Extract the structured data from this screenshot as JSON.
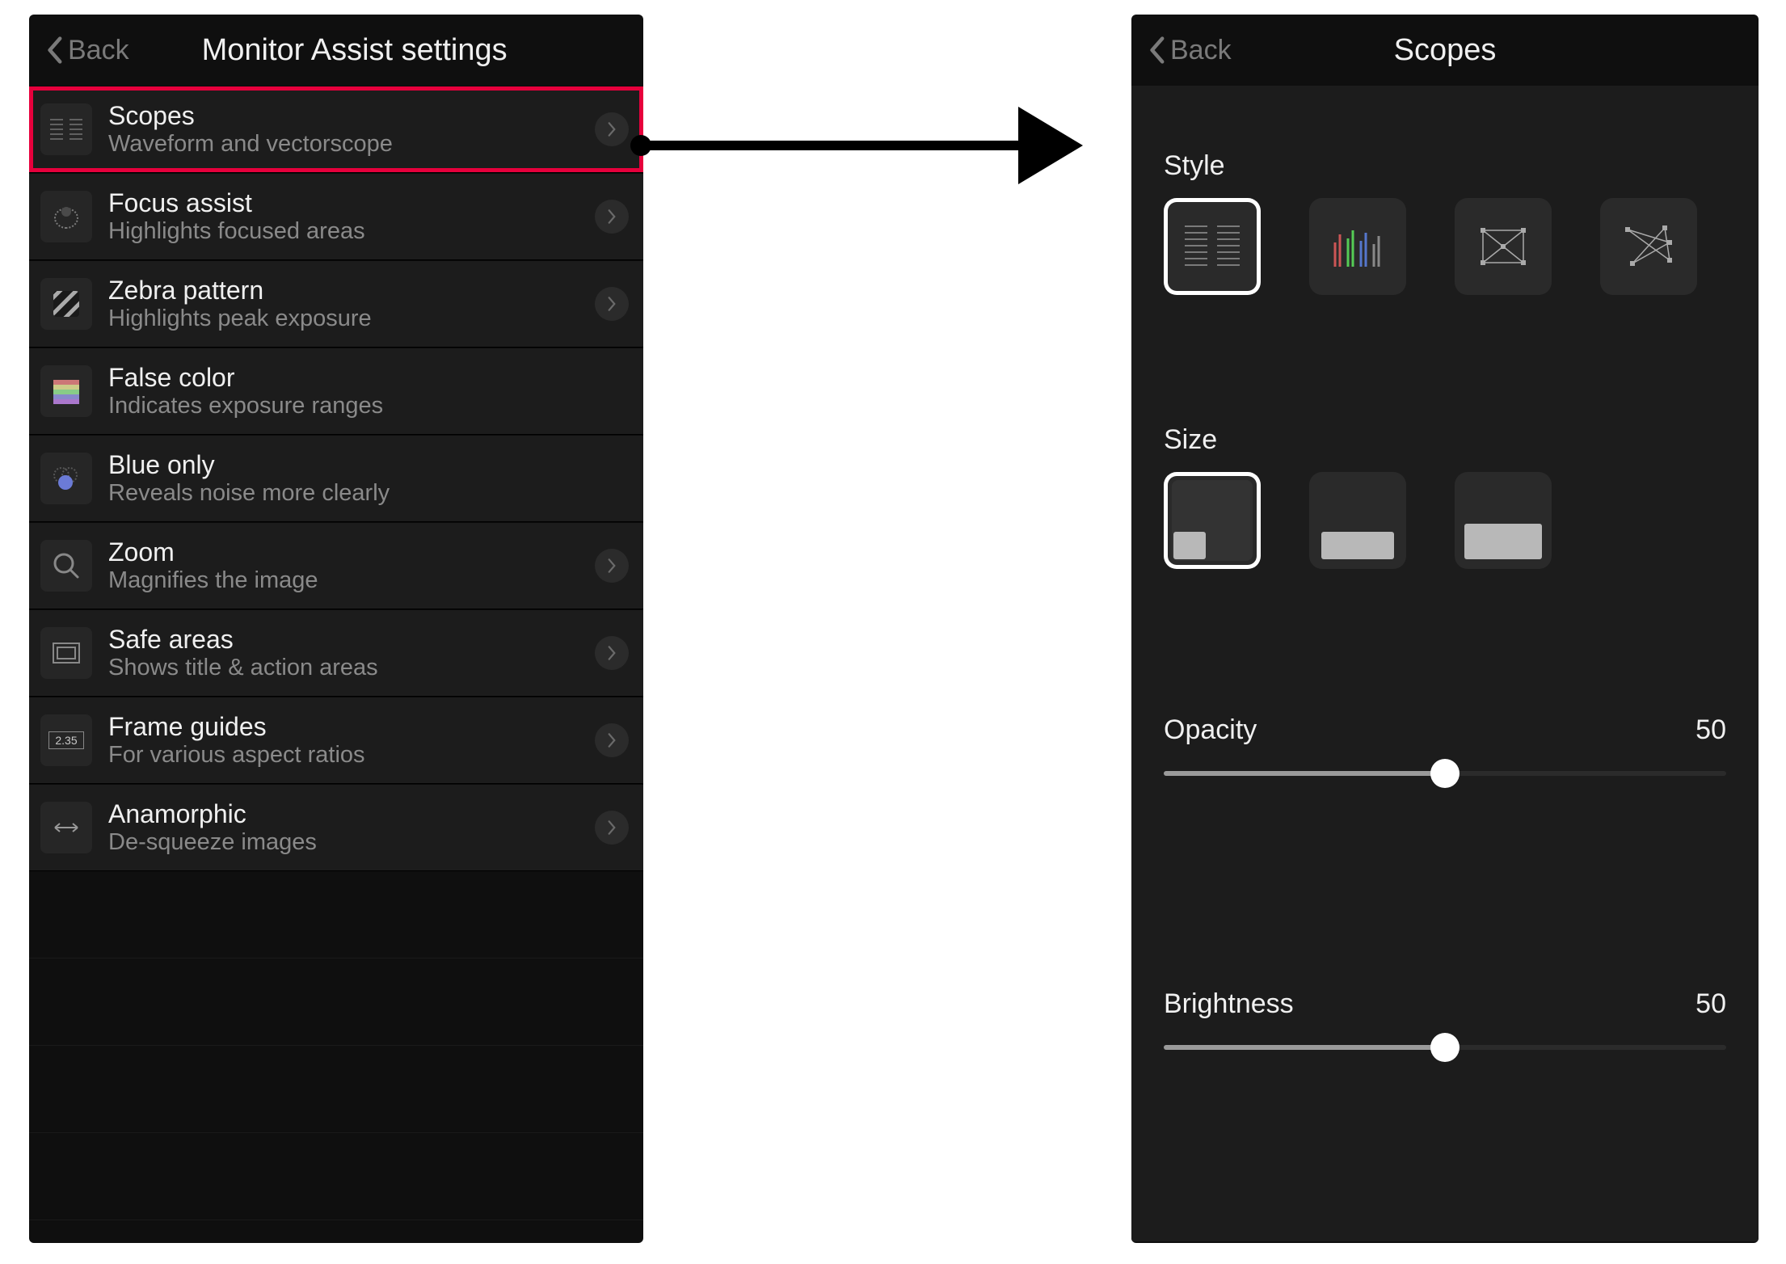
{
  "left_panel": {
    "back_label": "Back",
    "title": "Monitor Assist settings",
    "items": [
      {
        "title": "Scopes",
        "subtitle": "Waveform and vectorscope",
        "has_chevron": true,
        "highlighted": true,
        "icon": "scopes-icon"
      },
      {
        "title": "Focus assist",
        "subtitle": "Highlights focused areas",
        "has_chevron": true,
        "highlighted": false,
        "icon": "focus-assist-icon"
      },
      {
        "title": "Zebra pattern",
        "subtitle": "Highlights peak exposure",
        "has_chevron": true,
        "highlighted": false,
        "icon": "zebra-icon"
      },
      {
        "title": "False color",
        "subtitle": "Indicates exposure ranges",
        "has_chevron": false,
        "highlighted": false,
        "icon": "false-color-icon"
      },
      {
        "title": "Blue only",
        "subtitle": "Reveals noise more clearly",
        "has_chevron": false,
        "highlighted": false,
        "icon": "blue-only-icon"
      },
      {
        "title": "Zoom",
        "subtitle": "Magnifies the image",
        "has_chevron": true,
        "highlighted": false,
        "icon": "zoom-icon"
      },
      {
        "title": "Safe areas",
        "subtitle": "Shows title & action areas",
        "has_chevron": true,
        "highlighted": false,
        "icon": "safe-areas-icon"
      },
      {
        "title": "Frame guides",
        "subtitle": "For various aspect ratios",
        "has_chevron": true,
        "highlighted": false,
        "icon": "frame-guides-icon"
      },
      {
        "title": "Anamorphic",
        "subtitle": "De-squeeze images",
        "has_chevron": true,
        "highlighted": false,
        "icon": "anamorphic-icon"
      }
    ]
  },
  "right_panel": {
    "back_label": "Back",
    "title": "Scopes",
    "style_label": "Style",
    "styles": [
      {
        "name": "waveform-luma",
        "selected": true
      },
      {
        "name": "waveform-rgb",
        "selected": false
      },
      {
        "name": "vectorscope-a",
        "selected": false
      },
      {
        "name": "vectorscope-b",
        "selected": false
      }
    ],
    "size_label": "Size",
    "sizes": [
      {
        "name": "small",
        "selected": true
      },
      {
        "name": "medium",
        "selected": false
      },
      {
        "name": "large",
        "selected": false
      }
    ],
    "opacity": {
      "label": "Opacity",
      "value": 50,
      "min": 0,
      "max": 100
    },
    "brightness": {
      "label": "Brightness",
      "value": 50,
      "min": 0,
      "max": 100
    }
  },
  "frame_guides_badge": "2.35"
}
